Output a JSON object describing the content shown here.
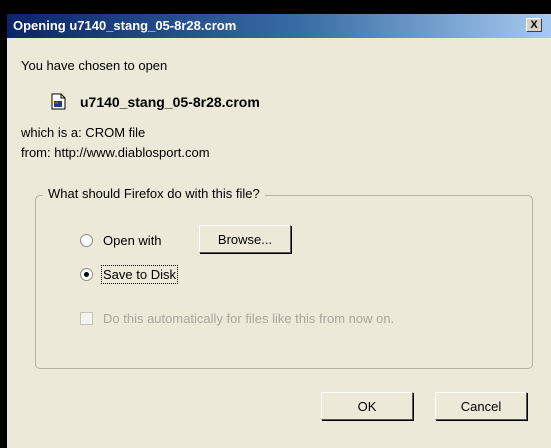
{
  "window": {
    "title": "Opening u7140_stang_05-8r28.crom",
    "close_label": "X"
  },
  "intro": {
    "chosen_text": "You have chosen to open",
    "file_name": "u7140_stang_05-8r28.crom",
    "file_icon": "document-icon",
    "type_text": "which is a:  CROM file",
    "from_text": "from:  http://www.diablosport.com"
  },
  "action_group": {
    "legend": "What should Firefox do with this file?",
    "open_with_label": "Open with",
    "open_with_selected": false,
    "browse_label": "Browse...",
    "save_label": "Save to Disk",
    "save_selected": true,
    "auto_label": "Do this automatically for files like this from now on.",
    "auto_checked": false,
    "auto_enabled": false
  },
  "buttons": {
    "ok_label": "OK",
    "cancel_label": "Cancel"
  }
}
